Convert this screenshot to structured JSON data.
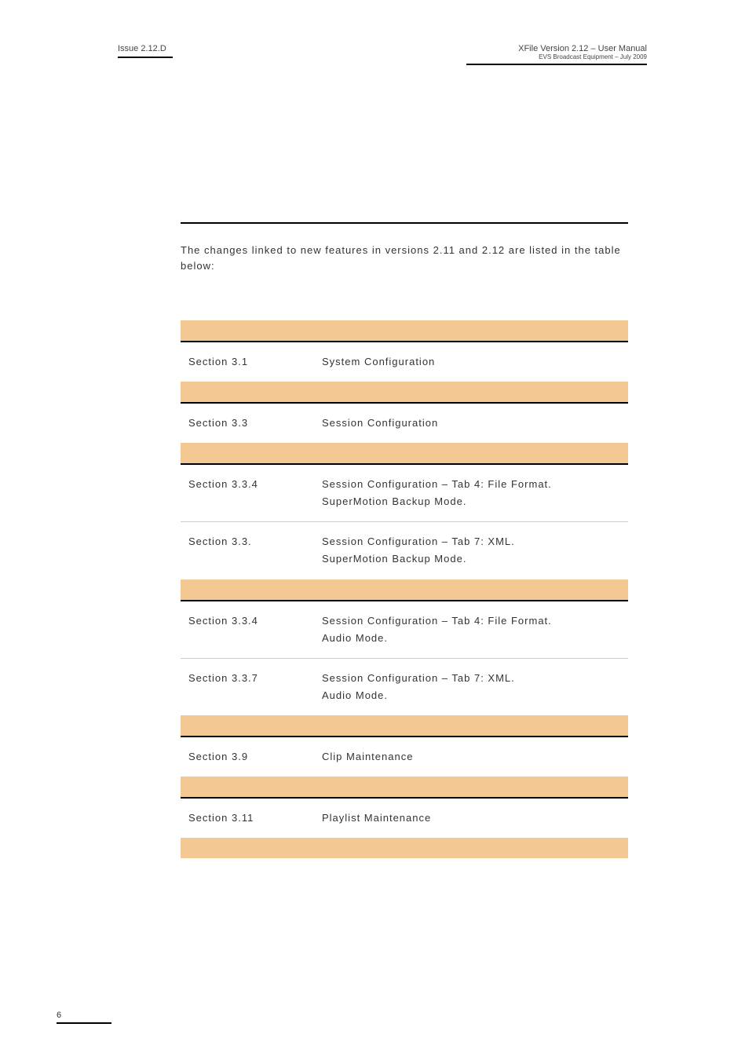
{
  "header": {
    "issue": "Issue 2.12.D",
    "manual_title": "XFile Version 2.12 – User Manual",
    "manual_sub": "EVS Broadcast Equipment – July 2009"
  },
  "intro": "The changes linked to new features in versions 2.11 and 2.12 are listed in the table below:",
  "rows": [
    {
      "sep": true
    },
    {
      "section": "Section 3.1",
      "desc": "System Configuration",
      "divider": false
    },
    {
      "sep": true
    },
    {
      "section": "Section 3.3",
      "desc": "Session Configuration",
      "divider": false
    },
    {
      "sep": true
    },
    {
      "section": "Section 3.3.4",
      "desc": "Session Configuration – Tab 4: File Format.\nSuperMotion Backup Mode.",
      "divider": true
    },
    {
      "section": "Section 3.3.",
      "desc": "Session Configuration – Tab 7: XML.\nSuperMotion Backup Mode.",
      "divider": false
    },
    {
      "sep": true
    },
    {
      "section": "Section 3.3.4",
      "desc": "Session Configuration – Tab 4: File Format.\nAudio Mode.",
      "divider": true
    },
    {
      "section": "Section 3.3.7",
      "desc": "Session Configuration – Tab 7: XML.\nAudio Mode.",
      "divider": false
    },
    {
      "sep": true
    },
    {
      "section": "Section 3.9",
      "desc": "Clip Maintenance",
      "divider": false
    },
    {
      "sep": true
    },
    {
      "section": "Section 3.11",
      "desc": "Playlist Maintenance",
      "divider": false
    },
    {
      "sep": true,
      "no_border": true
    }
  ],
  "footer": {
    "page_number": "6"
  }
}
